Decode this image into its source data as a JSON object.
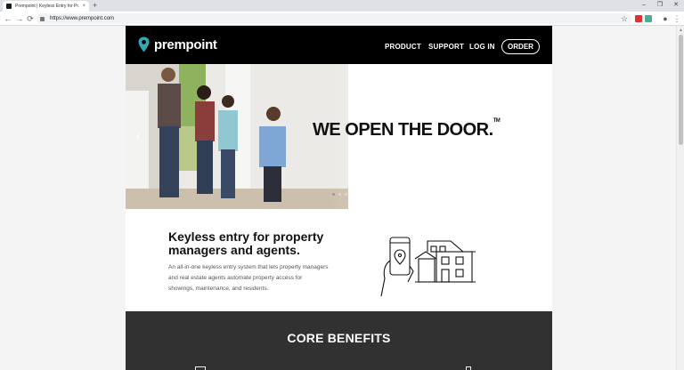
{
  "browser": {
    "tab_title": "Prempoint | Keyless Entry for Pr...",
    "tab_close": "×",
    "new_tab": "+",
    "window_controls": [
      "–",
      "❐",
      "✕"
    ],
    "url": "https://www.prempoint.com",
    "nav": [
      "←",
      "→",
      "⟳"
    ],
    "star": "☆",
    "menu": "⋮",
    "profile": "●",
    "ext_colors": [
      "#e0312e",
      "#4caf93"
    ]
  },
  "site": {
    "brand": "prempoint",
    "brand_color": "#37a6b5",
    "nav": {
      "product": "PRODUCT",
      "support": "SUPPORT",
      "login": "LOG IN",
      "order": "ORDER"
    },
    "hero": {
      "tagline": "WE OPEN THE DOOR.",
      "tm": "TM",
      "prev": "‹",
      "slides": 3,
      "active_slide": 0
    },
    "intro": {
      "heading": "Keyless entry for property managers and agents.",
      "body": "An all-in-one keyless entry system that lets property managers and real estate agents automate property access for showings, maintenance, and residents."
    },
    "benefits": {
      "heading": "CORE BENEFITS"
    }
  }
}
